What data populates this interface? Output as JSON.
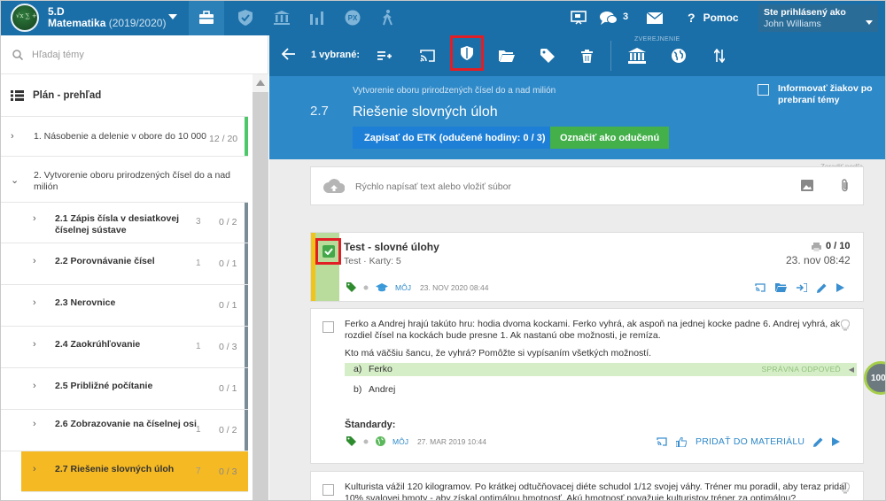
{
  "topbar": {
    "class_code": "5.D",
    "subject": "Matematika",
    "year": "(2019/2020)",
    "avatar_text": "√x ∑ +",
    "chat_count": "3",
    "help_label": "Pomoc",
    "help_icon": "?",
    "login_label": "Ste prihlásený ako",
    "user_name": "John Williams"
  },
  "sidebar": {
    "search_placeholder": "Hľadaj témy",
    "plan_label": "Plán - prehľad",
    "topics": [
      {
        "label": "1. Násobenie a delenie v obore do 10 000",
        "small": "12",
        "count": "/ 20"
      },
      {
        "label": "2. Vytvorenie oboru prirodzených čísel do a nad milión"
      }
    ],
    "subtopics": [
      {
        "label": "2.1 Zápis čísla v desiatkovej číselnej sústave",
        "small": "3",
        "count": "0 / 2"
      },
      {
        "label": "2.2 Porovnávanie čísel",
        "small": "1",
        "count": "0 / 1"
      },
      {
        "label": "2.3 Nerovnice",
        "small": "",
        "count": "0 / 1"
      },
      {
        "label": "2.4 Zaokrúhľovanie",
        "small": "1",
        "count": "0 / 3"
      },
      {
        "label": "2.5 Približné počítanie",
        "small": "",
        "count": "0 / 1"
      },
      {
        "label": "2.6 Zobrazovanie na číselnej osi",
        "small": "1",
        "count": "0 / 2"
      },
      {
        "label": "2.7 Riešenie slovných úloh",
        "small": "7",
        "count": "0 / 3"
      }
    ]
  },
  "actionbar": {
    "selected_label": "1 vybrané:",
    "publish_label": "ZVEREJNENIE"
  },
  "topic": {
    "number": "2.7",
    "parent": "Vytvorenie oboru prirodzených čísel do a nad milión",
    "title": "Riešenie slovných úloh",
    "etk_button": "Zapísať do ETK (odučené hodiny: 0 / 3)",
    "done_button": "Označiť ako odučenú",
    "inform_label": "Informovať žiakov po prebraní témy"
  },
  "content": {
    "faint_note": "Zoradiť podľa",
    "quick_placeholder": "Rýchlo napísať text alebo vložiť súbor",
    "test": {
      "title": "Test - slovné úlohy",
      "subtitle": "Test · Karty: 5",
      "score": "0 / 10",
      "date": "23. nov 08:42",
      "mine": "MÔJ",
      "meta_date": "23. NOV 2020 08:44"
    },
    "q1": {
      "text": "Ferko a Andrej hrajú takúto hru: hodia dvoma kockami. Ferko vyhrá, ak aspoň na jednej kocke padne 6. Andrej vyhrá, ak rozdiel čísel na kockách bude presne 1. Ak nastanú obe možnosti, je remíza.",
      "question": "Kto má väčšiu šancu, že vyhrá? Pomôžte si vypísaním všetkých možností.",
      "option_a_letter": "a)",
      "option_a": "Ferko",
      "correct_label": "SPRÁVNA ODPOVEĎ",
      "option_b_letter": "b)",
      "option_b": "Andrej",
      "standards_label": "Štandardy:",
      "mine": "MÔJ",
      "meta_date": "27. MAR 2019 10:44",
      "add_label": "PRIDAŤ DO MATERIÁLU"
    },
    "q2": {
      "text": "Kulturista vážil 120 kilogramov. Po krátkej odtučňovacej diéte schudol 1/12 svojej váhy. Tréner mu poradil, aby teraz pridal 10% svalovej hmoty - aby získal optimálnu hmotnosť. Akú hmotnosť považuje kulturistov tréner za optimálnu?"
    },
    "progress_label": "100"
  },
  "colors": {
    "topbar": "#1b6fa8",
    "topic_header": "#2e89c8",
    "active_topic": "#f5b923",
    "done_green": "#43b04a",
    "highlight_red": "#e21e25"
  },
  "icons": [
    "briefcase-icon",
    "shield-icon",
    "bank-icon",
    "bar-chart-icon",
    "px-icon",
    "hiking-icon",
    "present-icon",
    "chat-icon",
    "mail-icon",
    "search-icon",
    "list-icon",
    "back-arrow-icon",
    "add-list-icon",
    "cast-icon",
    "folder-icon",
    "tag-icon",
    "trash-icon",
    "globe-icon",
    "sort-icon",
    "cloud-upload-icon",
    "image-icon",
    "paperclip-icon",
    "print-icon",
    "graduation-cap-icon",
    "lightbulb-icon",
    "thumbs-up-icon",
    "edit-icon",
    "play-icon",
    "login-icon"
  ]
}
